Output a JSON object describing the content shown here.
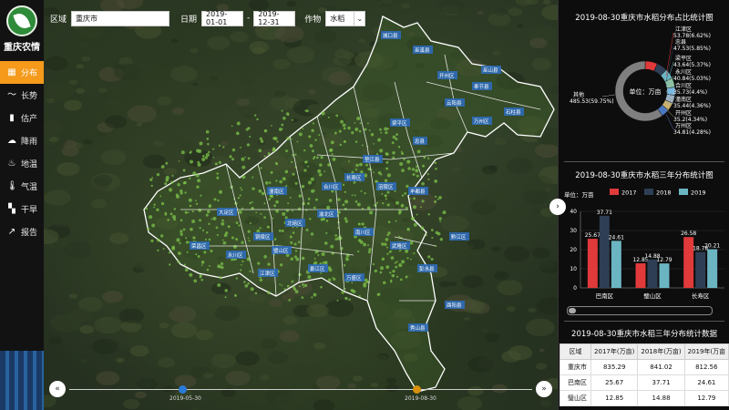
{
  "app": {
    "title": "重庆农情"
  },
  "nav": [
    {
      "label": "分布",
      "icon": "grid-icon",
      "glyph": "▦",
      "active": true
    },
    {
      "label": "长势",
      "icon": "trend-icon",
      "glyph": "〜",
      "active": false
    },
    {
      "label": "估产",
      "icon": "bar-chart-icon",
      "glyph": "▮",
      "active": false
    },
    {
      "label": "降雨",
      "icon": "rain-cloud-icon",
      "glyph": "☁",
      "active": false
    },
    {
      "label": "地温",
      "icon": "soil-temperature-icon",
      "glyph": "♨",
      "active": false
    },
    {
      "label": "气温",
      "icon": "thermometer-icon",
      "glyph": "🌡",
      "active": false
    },
    {
      "label": "干旱",
      "icon": "map-icon",
      "glyph": "▚",
      "active": false
    },
    {
      "label": "报告",
      "icon": "report-icon",
      "glyph": "↗",
      "active": false
    }
  ],
  "filters": {
    "region_label": "区域",
    "region_value": "重庆市",
    "date_label": "日期",
    "date_start": "2019-01-01",
    "date_sep": "-",
    "date_end": "2019-12-31",
    "crop_label": "作物",
    "crop_value": "水稻"
  },
  "timeline": {
    "prev_glyph": "«",
    "next_glyph": "»",
    "marker1_label": "2019-05-30",
    "marker1_color": "#2a7bd8",
    "marker2_label": "2019-08-30",
    "marker2_color": "#d8900a"
  },
  "map_labels": [
    "城口县",
    "巫溪县",
    "开州区",
    "巫山县",
    "奉节县",
    "云阳县",
    "万州区",
    "梁平区",
    "忠县",
    "石柱县",
    "垫江县",
    "长寿区",
    "涪陵区",
    "丰都县",
    "合川区",
    "潼南区",
    "北碚区",
    "渝北区",
    "铜梁区",
    "大足区",
    "荣昌区",
    "永川区",
    "江津区",
    "綦江区",
    "南川区",
    "武隆区",
    "彭水县",
    "黔江区",
    "酉阳县",
    "秀山县",
    "万盛区",
    "璧山区"
  ],
  "pie": {
    "title": "2019-08-30重庆市水稻分布占比统计图",
    "center_label": "单位：万亩",
    "slices": [
      {
        "name": "江津区",
        "label": "53.78(6.62%)",
        "value": 53.78,
        "color": "#e03a3a"
      },
      {
        "name": "忠县",
        "label": "47.53(5.85%)",
        "value": 47.53,
        "color": "#2e3f55"
      },
      {
        "name": "梁平区",
        "label": "43.64(5.37%)",
        "value": 43.64,
        "color": "#6bb5c2"
      },
      {
        "name": "永川区",
        "label": "40.84(5.03%)",
        "value": 40.84,
        "color": "#8ec1a3"
      },
      {
        "name": "合川区",
        "label": "35.73(4.4%)",
        "value": 35.73,
        "color": "#7ab8e0"
      },
      {
        "name": "潼南区",
        "label": "35.44(4.36%)",
        "value": 35.44,
        "color": "#9db0c2"
      },
      {
        "name": "开州区",
        "label": "35.2(4.34%)",
        "value": 35.2,
        "color": "#c8b06e"
      },
      {
        "name": "万州区",
        "label": "34.81(4.28%)",
        "value": 34.81,
        "color": "#4a78c0"
      },
      {
        "name": "其他",
        "label": "485.53(59.75%)",
        "value": 485.53,
        "color": "#7f7f7f"
      }
    ]
  },
  "chart_data": {
    "type": "bar",
    "title": "2019-08-30重庆市水稻三年分布统计图",
    "unit_label": "单位：万亩",
    "categories": [
      "巴南区",
      "璧山区",
      "长寿区"
    ],
    "series": [
      {
        "name": "2017",
        "values": [
          25.67,
          12.85,
          26.58
        ],
        "color": "#e03a3a"
      },
      {
        "name": "2018",
        "values": [
          37.71,
          14.88,
          18.78
        ],
        "color": "#2e3f55"
      },
      {
        "name": "2019",
        "values": [
          24.61,
          12.79,
          20.21
        ],
        "color": "#6bb5c2"
      }
    ],
    "ylim": [
      0,
      40
    ],
    "yticks": [
      0,
      10,
      20,
      30,
      40
    ],
    "grid": true,
    "legend": "top"
  },
  "table": {
    "title": "2019-08-30重庆市水稻三年分布统计数据",
    "headers": [
      "区域",
      "2017年(万亩)",
      "2018年(万亩)",
      "2019年(万亩"
    ],
    "rows": [
      [
        "重庆市",
        "835.29",
        "841.02",
        "812.56"
      ],
      [
        "巴南区",
        "25.67",
        "37.71",
        "24.61"
      ],
      [
        "璧山区",
        "12.85",
        "14.88",
        "12.79"
      ]
    ]
  },
  "panel": {
    "collapse_glyph": "›"
  }
}
